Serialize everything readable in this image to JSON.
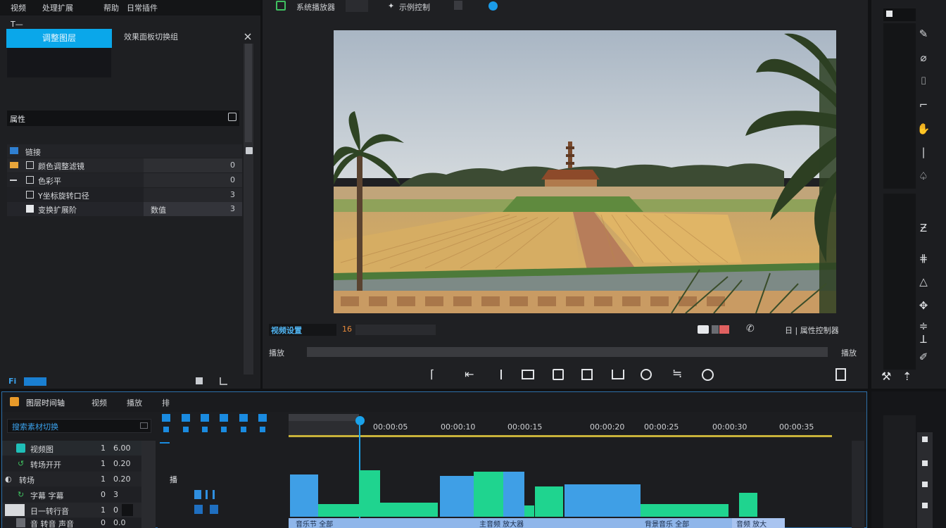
{
  "menu": {
    "item1": "视频",
    "item2": "处理扩展",
    "item3": "帮助",
    "item4": "日常插件"
  },
  "left_panel": {
    "tool_label": "T—",
    "effect_title": "效果面板切换组",
    "selected_button": "调整图层",
    "props_header": "属性",
    "props_subheader": "链接",
    "rows": [
      {
        "name": "颜色调整滤镜",
        "value": "0"
      },
      {
        "name": "色彩平",
        "value": "0"
      },
      {
        "name": "Y坐标旋转口径",
        "value": "3"
      },
      {
        "name": "变换扩展阶",
        "value": "3",
        "cell": "数值"
      }
    ],
    "bottom_left": "Fi"
  },
  "preview": {
    "toolbar_label1": "系统播放器",
    "toolbar_label2": "示例控制",
    "status_left": "视频设置",
    "status_badge": "16",
    "status_right": "日 | 属性控制器",
    "scrub_left": "播放",
    "scrub_right": "播放"
  },
  "timeline": {
    "tabs": [
      "图层时间轴",
      "视频",
      "播放",
      "排"
    ],
    "search_placeholder": "搜索素材切换",
    "tracks": [
      {
        "name": "视频图",
        "v1": "1",
        "v2": "6.00"
      },
      {
        "name": "转场开开",
        "v1": "1",
        "v2": "0.20"
      },
      {
        "name": "转场",
        "v1": "1",
        "v2": "0.20"
      },
      {
        "name": "字幕 字幕",
        "v1": "0",
        "v2": "3"
      },
      {
        "name": "日一转行音",
        "v1": "1",
        "v2": "0"
      },
      {
        "name": "音 转音 声音",
        "v1": "0",
        "v2": "0.0"
      }
    ],
    "ruler_labels": [
      "00:00:05",
      "00:00:10",
      "00:00:15",
      "00:00:20",
      "00:00:25",
      "00:00:30",
      "00:00:35"
    ],
    "mid_label": "播",
    "clip_labels": [
      "音乐节 全部",
      "主音频 放大器",
      "背景音乐 全部",
      "音频 放大"
    ]
  },
  "colors": {
    "accent": "#0aa7ea",
    "clip_blue": "#3f9fe6",
    "clip_green": "#1fd48f",
    "ruler_yellow": "#c8b23a"
  }
}
